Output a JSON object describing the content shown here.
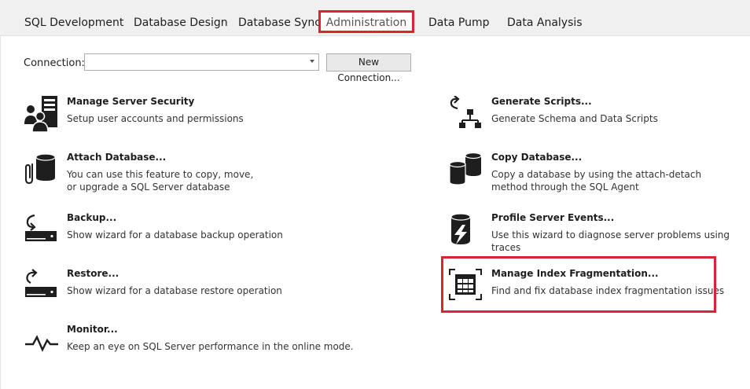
{
  "tabs": [
    {
      "label": "SQL Development"
    },
    {
      "label": "Database Design"
    },
    {
      "label": "Database Sync"
    },
    {
      "label": "Administration"
    },
    {
      "label": "Data Pump"
    },
    {
      "label": "Data Analysis"
    }
  ],
  "connection": {
    "label": "Connection:",
    "value": "",
    "new_button_label": "New Connection..."
  },
  "features_left": [
    {
      "title": "Manage Server Security",
      "desc": "Setup user accounts and permissions",
      "icon": "server-security-icon"
    },
    {
      "title": "Attach Database...",
      "desc": "You can use this feature to copy, move,\nor upgrade a SQL Server database",
      "icon": "attach-database-icon"
    },
    {
      "title": "Backup...",
      "desc": "Show wizard for a database backup operation",
      "icon": "backup-icon"
    },
    {
      "title": "Restore...",
      "desc": "Show wizard for a database restore operation",
      "icon": "restore-icon"
    },
    {
      "title": "Monitor...",
      "desc": "Keep an eye on SQL Server performance in the online mode.",
      "icon": "monitor-icon"
    }
  ],
  "features_right": [
    {
      "title": "Generate Scripts...",
      "desc": "Generate Schema and Data Scripts",
      "icon": "generate-scripts-icon"
    },
    {
      "title": "Copy Database...",
      "desc": "Copy a database by using the attach-detach\nmethod through the SQL Agent",
      "icon": "copy-database-icon"
    },
    {
      "title": "Profile Server Events...",
      "desc": "Use this wizard to diagnose server problems using traces",
      "icon": "profile-events-icon"
    },
    {
      "title": "Manage Index Fragmentation...",
      "desc": "Find and fix database index fragmentation issues",
      "icon": "index-fragmentation-icon"
    }
  ],
  "colors": {
    "highlight": "#d7262f",
    "icon": "#1e1e1e"
  }
}
